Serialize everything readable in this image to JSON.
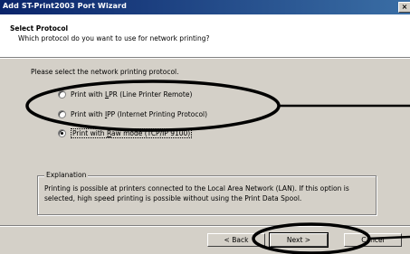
{
  "window": {
    "title": "Add ST-Print2003 Port Wizard",
    "close_glyph": "×"
  },
  "header": {
    "title": "Select Protocol",
    "subtitle": "Which protocol do you want to use for network printing?"
  },
  "prompt": "Please select the network printing protocol.",
  "options": [
    {
      "pre": "Print with ",
      "key": "L",
      "post": "PR (Line Printer Remote)",
      "selected": false
    },
    {
      "pre": "Print with ",
      "key": "I",
      "post": "PP (Internet Printing Protocol)",
      "selected": false
    },
    {
      "pre": "Print with ",
      "key": "R",
      "post": "aw mode (TCP/IP 9100)",
      "selected": true
    }
  ],
  "explanation": {
    "legend": "Explanation",
    "text": "Printing is possible at printers connected to the Local Area Network (LAN). If this option is selected, high speed printing is possible without using the Print Data Spool."
  },
  "buttons": {
    "back": "< Back",
    "next": "Next >",
    "cancel": "Cancel"
  },
  "colors": {
    "dialog_bg": "#d4d0c8",
    "title_start": "#0a246a",
    "title_end": "#3a6ea5",
    "annotation": "#000000"
  }
}
